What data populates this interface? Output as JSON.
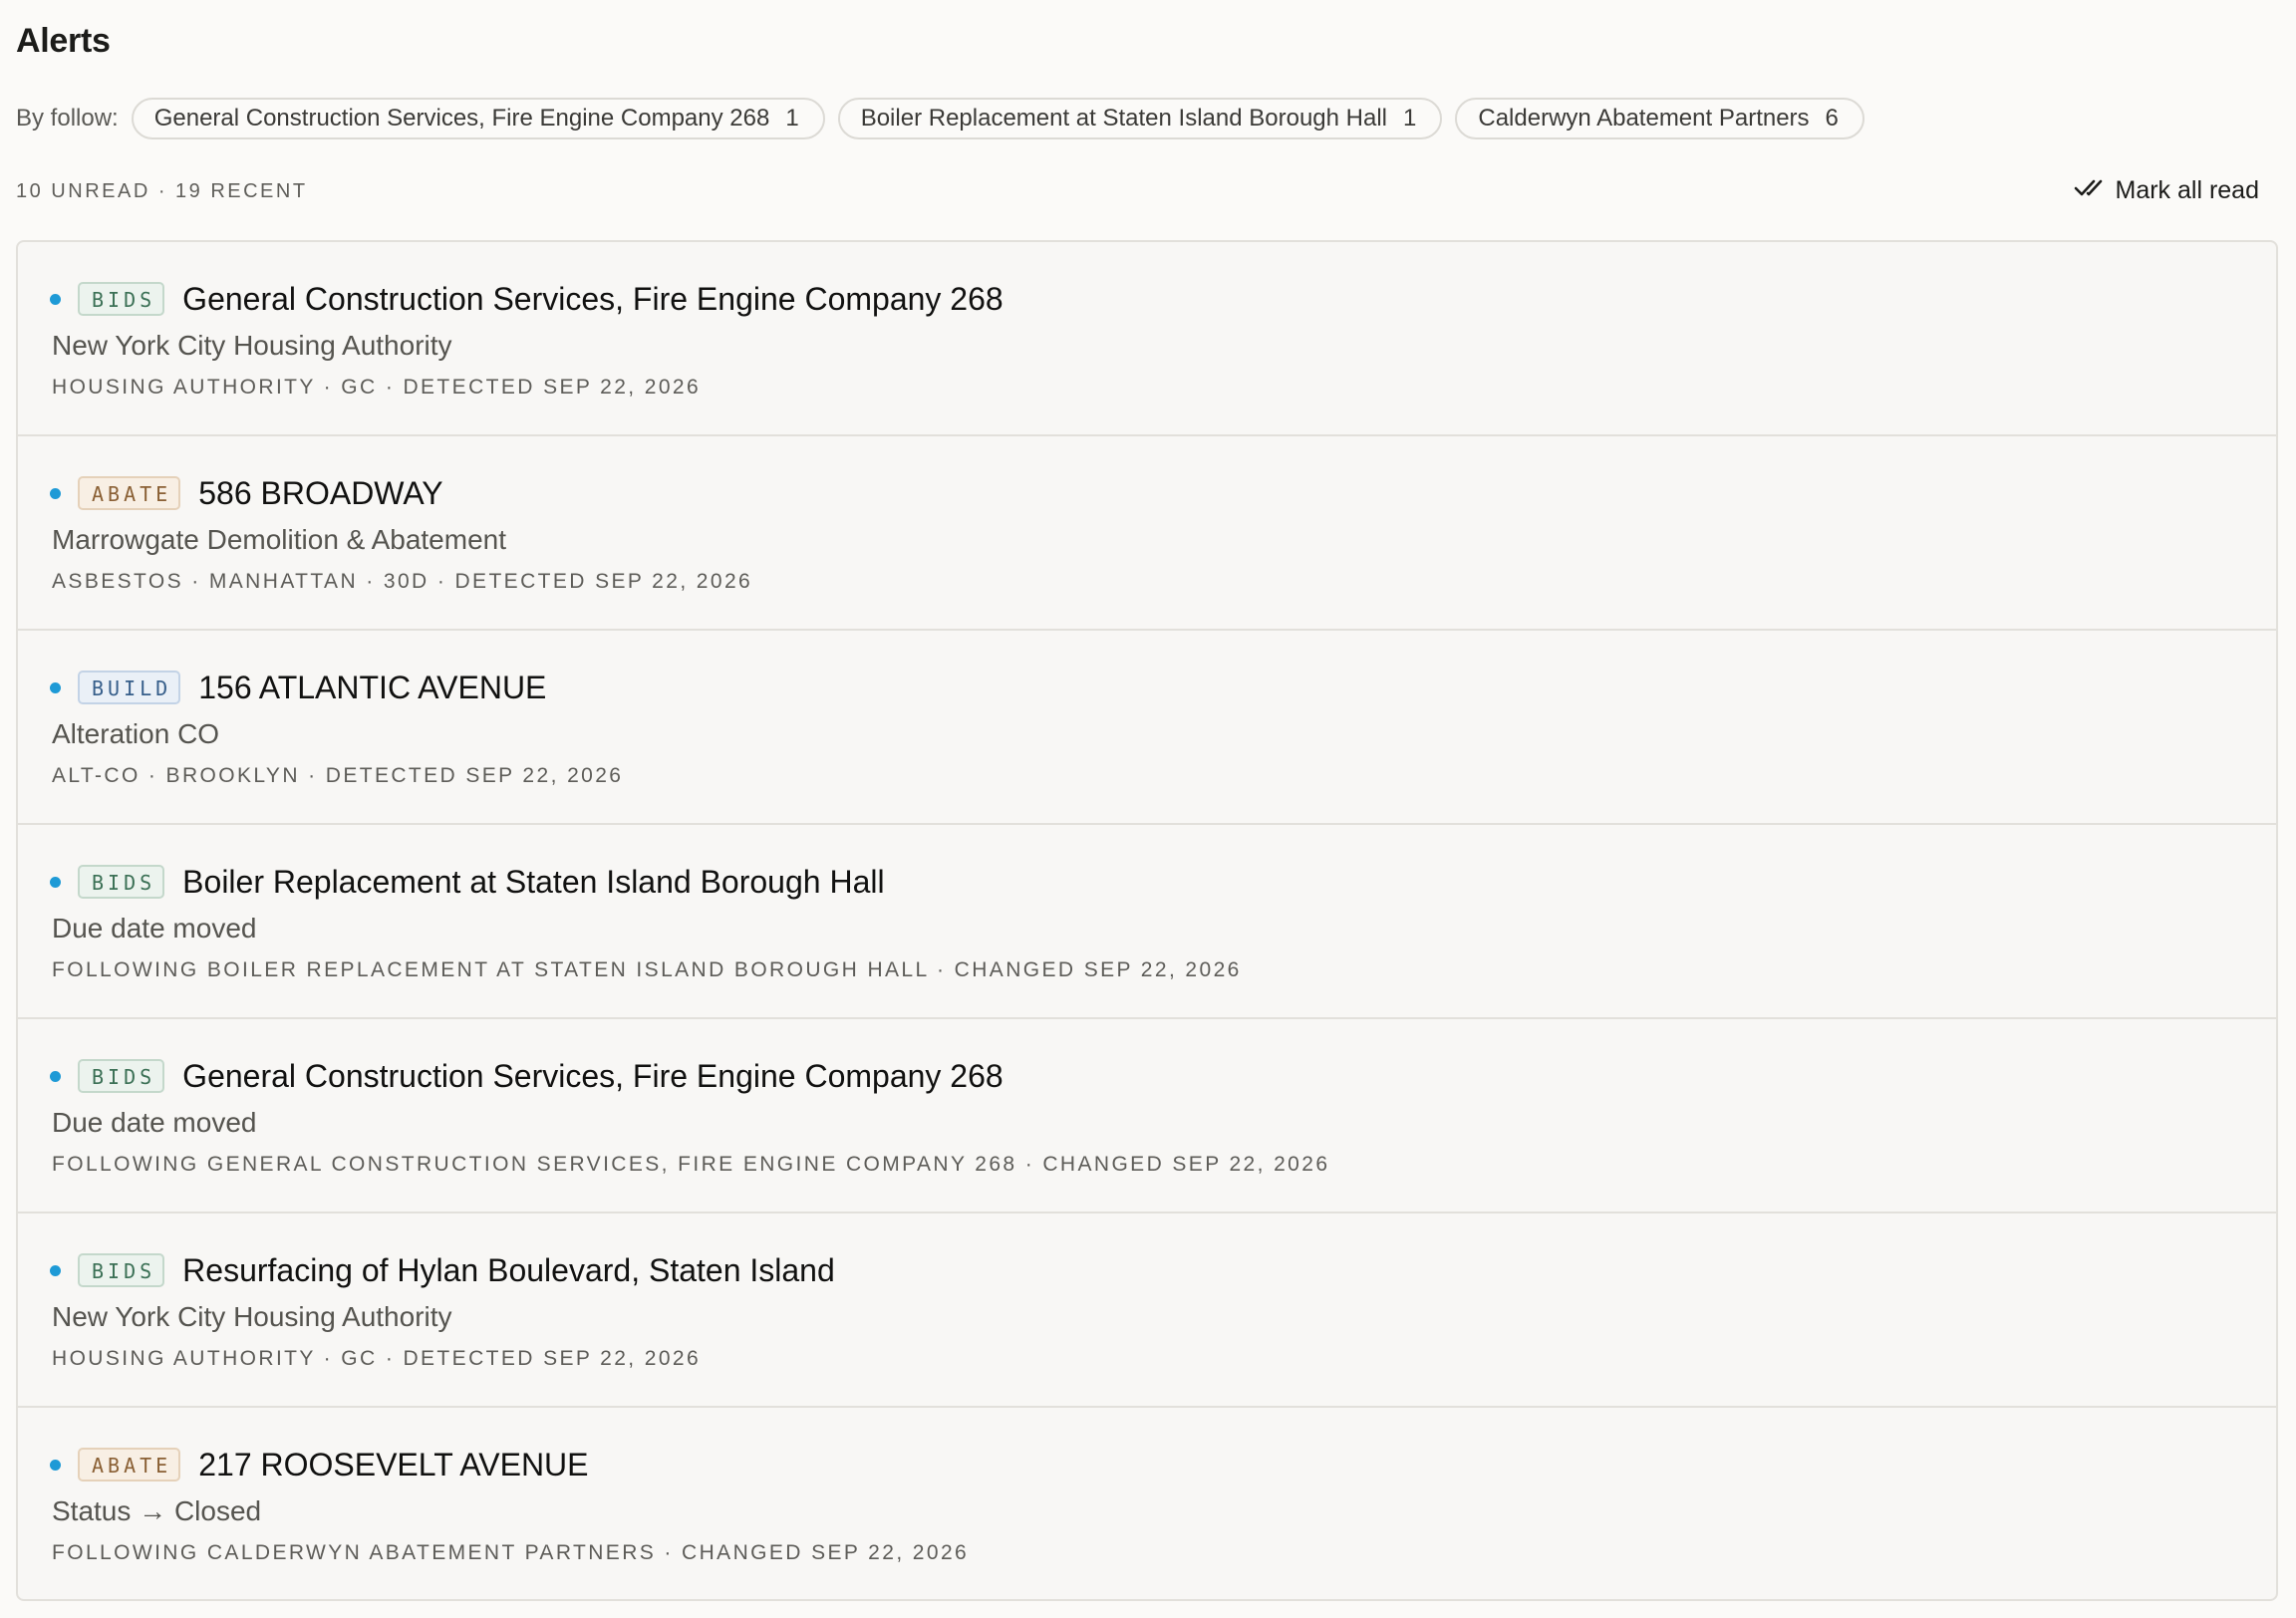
{
  "page_title": "Alerts",
  "follow": {
    "label": "By follow:",
    "chips": [
      {
        "name": "General Construction Services, Fire Engine Company 268",
        "count": "1"
      },
      {
        "name": "Boiler Replacement at Staten Island Borough Hall",
        "count": "1"
      },
      {
        "name": "Calderwyn Abatement Partners",
        "count": "6"
      }
    ]
  },
  "summary": {
    "counts": "10 UNREAD · 19 RECENT",
    "mark_all_read": "Mark all read",
    "mark_all_read_icon": "double-check-icon"
  },
  "colors": {
    "unread_dot": "#1e9ad6",
    "bids": "#3b7055",
    "abate": "#8a6035",
    "build": "#365e8a"
  },
  "alerts": [
    {
      "unread": true,
      "badge": "BIDS",
      "badge_kind": "bids",
      "title": "General Construction Services, Fire Engine Company 268",
      "subtitle": "New York City Housing Authority",
      "meta": "HOUSING AUTHORITY · GC · DETECTED SEP 22, 2026"
    },
    {
      "unread": true,
      "badge": "ABATE",
      "badge_kind": "abate",
      "title": "586 BROADWAY",
      "subtitle": "Marrowgate Demolition & Abatement",
      "meta": "ASBESTOS · MANHATTAN · 30D · DETECTED SEP 22, 2026"
    },
    {
      "unread": true,
      "badge": "BUILD",
      "badge_kind": "build",
      "title": "156 ATLANTIC AVENUE",
      "subtitle": "Alteration CO",
      "meta": "ALT-CO · BROOKLYN · DETECTED SEP 22, 2026"
    },
    {
      "unread": true,
      "badge": "BIDS",
      "badge_kind": "bids",
      "title": "Boiler Replacement at Staten Island Borough Hall",
      "subtitle": "Due date moved",
      "meta": "FOLLOWING BOILER REPLACEMENT AT STATEN ISLAND BOROUGH HALL · CHANGED SEP 22, 2026"
    },
    {
      "unread": true,
      "badge": "BIDS",
      "badge_kind": "bids",
      "title": "General Construction Services, Fire Engine Company 268",
      "subtitle": "Due date moved",
      "meta": "FOLLOWING GENERAL CONSTRUCTION SERVICES, FIRE ENGINE COMPANY 268 · CHANGED SEP 22, 2026"
    },
    {
      "unread": true,
      "badge": "BIDS",
      "badge_kind": "bids",
      "title": "Resurfacing of Hylan Boulevard, Staten Island",
      "subtitle": "New York City Housing Authority",
      "meta": "HOUSING AUTHORITY · GC · DETECTED SEP 22, 2026"
    },
    {
      "unread": true,
      "badge": "ABATE",
      "badge_kind": "abate",
      "title": "217 ROOSEVELT AVENUE",
      "subtitle": "Status → Closed",
      "meta": "FOLLOWING CALDERWYN ABATEMENT PARTNERS · CHANGED SEP 22, 2026"
    }
  ]
}
